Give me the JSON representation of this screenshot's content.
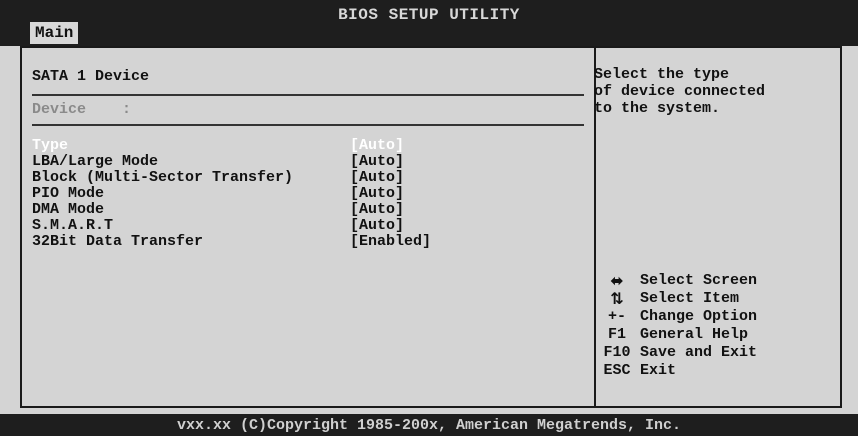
{
  "header": {
    "title": "BIOS SETUP UTILITY",
    "tab": "Main"
  },
  "panel": {
    "section_title": "SATA 1 Device",
    "device_label": "Device",
    "device_separator": ":",
    "settings": [
      {
        "label": "Type",
        "value": "[Auto]",
        "selected": true
      },
      {
        "label": "LBA/Large Mode",
        "value": "[Auto]"
      },
      {
        "label": "Block (Multi-Sector Transfer)",
        "value": "[Auto]"
      },
      {
        "label": "PIO Mode",
        "value": "[Auto]"
      },
      {
        "label": "DMA Mode",
        "value": "[Auto]"
      },
      {
        "label": "S.M.A.R.T",
        "value": "[Auto]"
      },
      {
        "label": "32Bit Data Transfer",
        "value": "[Enabled]"
      }
    ]
  },
  "help": {
    "lines": [
      "Select the type",
      "of device connected",
      "to the system."
    ]
  },
  "keys": [
    {
      "key": "⬌",
      "icon": "left-right-arrows-icon",
      "desc": "Select Screen"
    },
    {
      "key": "⇅",
      "icon": "up-down-arrows-icon",
      "desc": "Select Item"
    },
    {
      "key": "+-",
      "desc": "Change Option"
    },
    {
      "key": "F1",
      "desc": "General Help"
    },
    {
      "key": "F10",
      "desc": "Save and Exit"
    },
    {
      "key": "ESC",
      "desc": "Exit"
    }
  ],
  "footer": {
    "copyright": "vxx.xx (C)Copyright 1985-200x, American Megatrends, Inc."
  }
}
